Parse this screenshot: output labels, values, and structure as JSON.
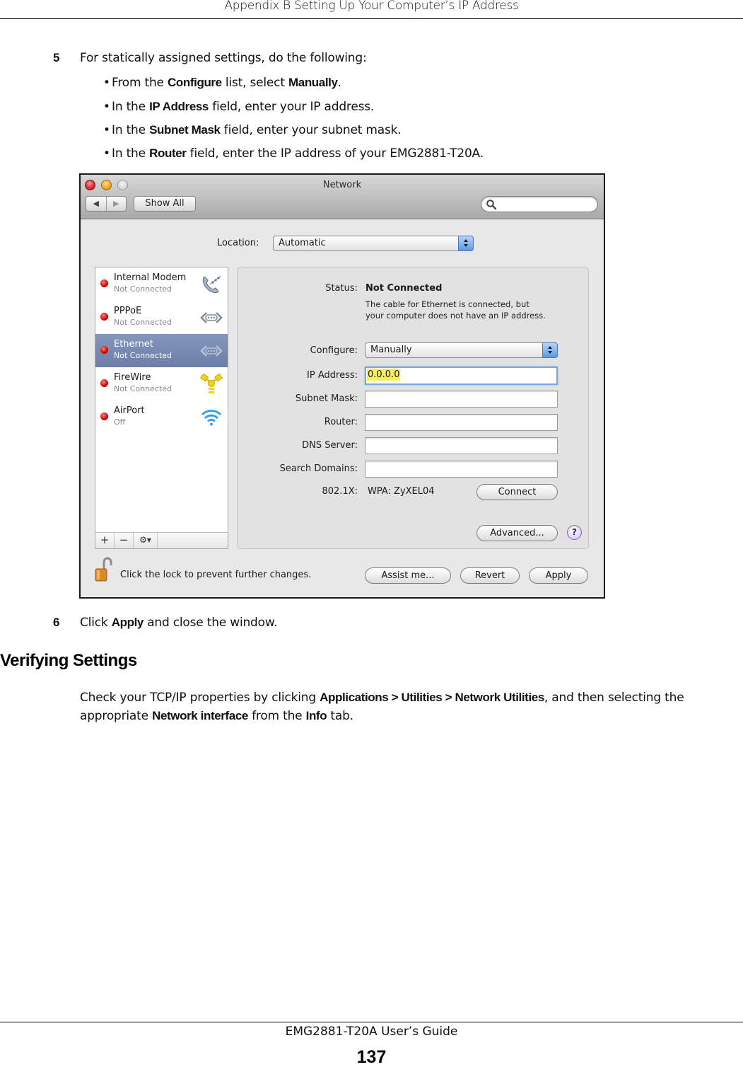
{
  "page": {
    "header": "Appendix B Setting Up Your Computer’s IP Address",
    "footer_title": "EMG2881-T20A User’s Guide",
    "page_number": "137"
  },
  "step5": {
    "number": "5",
    "text": "For statically assigned settings, do the following:",
    "bullets": [
      {
        "pre": "From the ",
        "bold": "Configure",
        "mid": " list, select ",
        "bold2": "Manually",
        "post": "."
      },
      {
        "pre": "In the ",
        "bold": "IP Address",
        "post": " field, enter your IP address."
      },
      {
        "pre": "In the ",
        "bold": "Subnet Mask",
        "post": " field, enter your subnet mask."
      },
      {
        "pre": "In the ",
        "bold": "Router",
        "post": " field, enter the IP address of your EMG2881-T20A."
      }
    ]
  },
  "step6": {
    "number": "6",
    "pre": "Click ",
    "bold": "Apply",
    "post": " and close the window."
  },
  "section": {
    "heading": "Verifying Settings",
    "p_pre": "Check your TCP/IP properties by clicking ",
    "p_bold1": "Applications > Utilities > Network Utilities",
    "p_mid": ", and then selecting the appropriate ",
    "p_bold2": "Network interface",
    "p_mid2": " from the ",
    "p_bold3": "Info",
    "p_post": " tab."
  },
  "window": {
    "title": "Network",
    "back_icon": "◀",
    "forward_icon": "▶",
    "show_all": "Show All",
    "search_placeholder": "",
    "location_label": "Location:",
    "location_value": "Automatic",
    "services": [
      {
        "name": "Internal Modem",
        "status": "Not Connected",
        "icon": "phone-icon",
        "selected": false
      },
      {
        "name": "PPPoE",
        "status": "Not Connected",
        "icon": "ethernet-icon",
        "selected": false
      },
      {
        "name": "Ethernet",
        "status": "Not Connected",
        "icon": "ethernet-icon",
        "selected": true
      },
      {
        "name": "FireWire",
        "status": "Not Connected",
        "icon": "firewire-icon",
        "selected": false
      },
      {
        "name": "AirPort",
        "status": "Off",
        "icon": "wifi-icon",
        "selected": false
      }
    ],
    "sidebar_add": "+",
    "sidebar_remove": "−",
    "sidebar_gear": "⚙▾",
    "status_label": "Status:",
    "status_value": "Not Connected",
    "status_description_1": "The cable for Ethernet is connected, but",
    "status_description_2": "your computer does not have an IP address.",
    "configure_label": "Configure:",
    "configure_value": "Manually",
    "ip_label": "IP Address:",
    "ip_value": "0.0.0.0",
    "subnet_label": "Subnet Mask:",
    "subnet_value": "",
    "router_label": "Router:",
    "router_value": "",
    "dns_label": "DNS Server:",
    "dns_value": "",
    "search_domains_label": "Search Domains:",
    "search_domains_value": "",
    "dot1x_label": "802.1X:",
    "dot1x_value": "WPA: ZyXEL04",
    "connect_button": "Connect",
    "advanced_button": "Advanced...",
    "help_button": "?",
    "lock_text": "Click the lock to prevent further changes.",
    "assist_button": "Assist me...",
    "revert_button": "Revert",
    "apply_button": "Apply",
    "colors": {
      "selected_row": "#7485ad",
      "led_red": "#d00000",
      "focus_ring": "#7ca6dc",
      "ip_highlight": "#f8ed5a"
    }
  }
}
